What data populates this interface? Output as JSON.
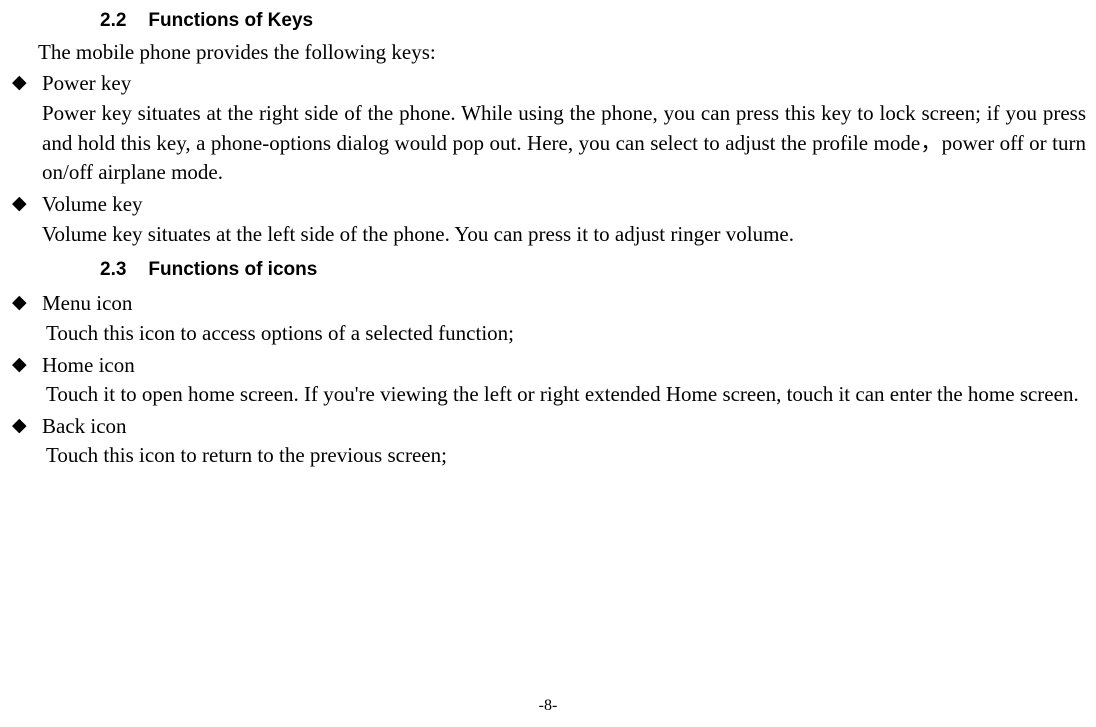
{
  "section22": {
    "number": "2.2",
    "title": "Functions of Keys",
    "intro": "The mobile phone provides the following keys:",
    "items": [
      {
        "label": "Power key",
        "body": "Power key situates at the right side of the phone. While using the phone, you can press this key to lock screen; if you press and hold this key, a phone-options dialog would pop out. Here, you can select to adjust the profile mode，power off or turn on/off airplane mode."
      },
      {
        "label": "Volume key",
        "body": "Volume key situates at the left side of the phone. You can press it to adjust ringer volume."
      }
    ]
  },
  "section23": {
    "number": "2.3",
    "title": "Functions of icons",
    "items": [
      {
        "label": "Menu icon",
        "body": "Touch this icon to access options of a selected function;"
      },
      {
        "label": "Home icon",
        "body": "Touch it to open home screen. If you're viewing the left or right extended Home screen, touch it can enter the home screen."
      },
      {
        "label": "Back icon",
        "body": "Touch this icon to return to the previous screen;"
      }
    ]
  },
  "pageNumber": "-8-"
}
